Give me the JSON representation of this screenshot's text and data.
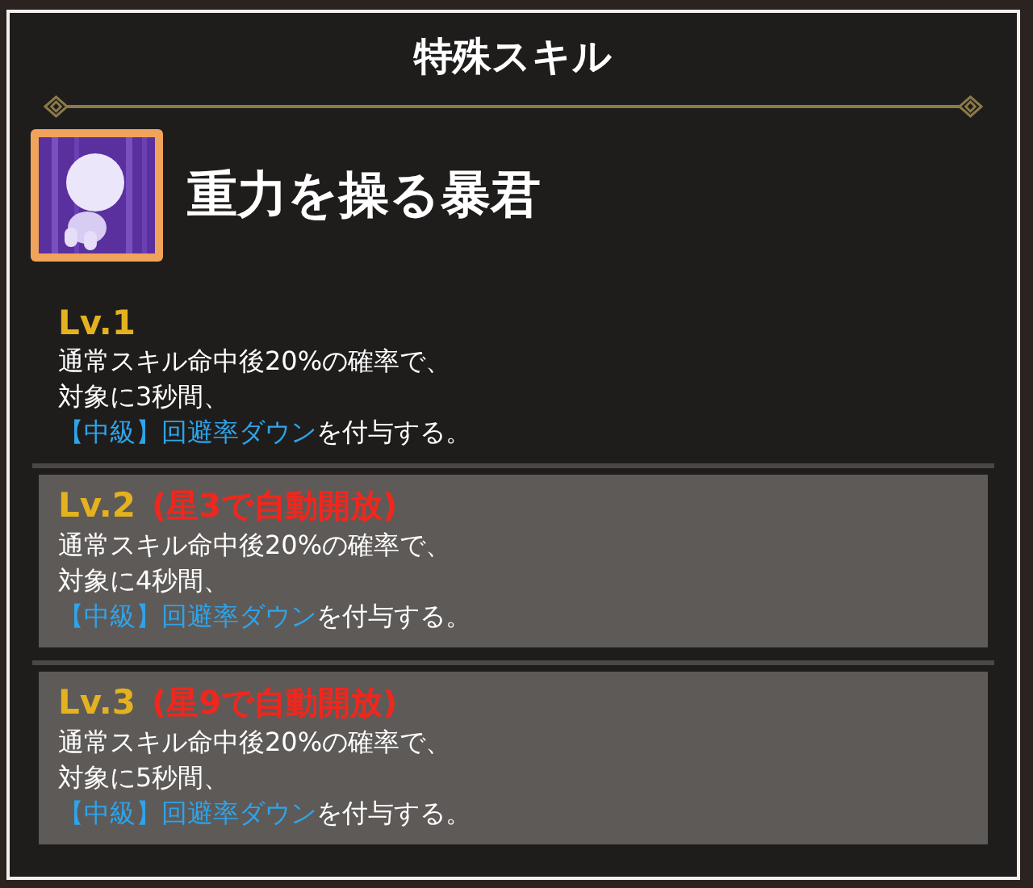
{
  "title": "特殊スキル",
  "skill": {
    "name": "重力を操る暴君"
  },
  "levels": [
    {
      "label": "Lv.1",
      "locked": false,
      "description": [
        "通常スキル命中後20%の確率で、",
        "対象に3秒間、"
      ],
      "effect_term": "【中級】回避率ダウン",
      "effect_suffix": "を付与する。"
    },
    {
      "label": "Lv.2",
      "locked": true,
      "unlock_note": "(星3で自動開放)",
      "description": [
        "通常スキル命中後20%の確率で、",
        "対象に4秒間、"
      ],
      "effect_term": "【中級】回避率ダウン",
      "effect_suffix": "を付与する。"
    },
    {
      "label": "Lv.3",
      "locked": true,
      "unlock_note": "(星9で自動開放)",
      "description": [
        "通常スキル命中後20%の確率で、",
        "対象に5秒間、"
      ],
      "effect_term": "【中級】回避率ダウン",
      "effect_suffix": "を付与する。"
    }
  ]
}
